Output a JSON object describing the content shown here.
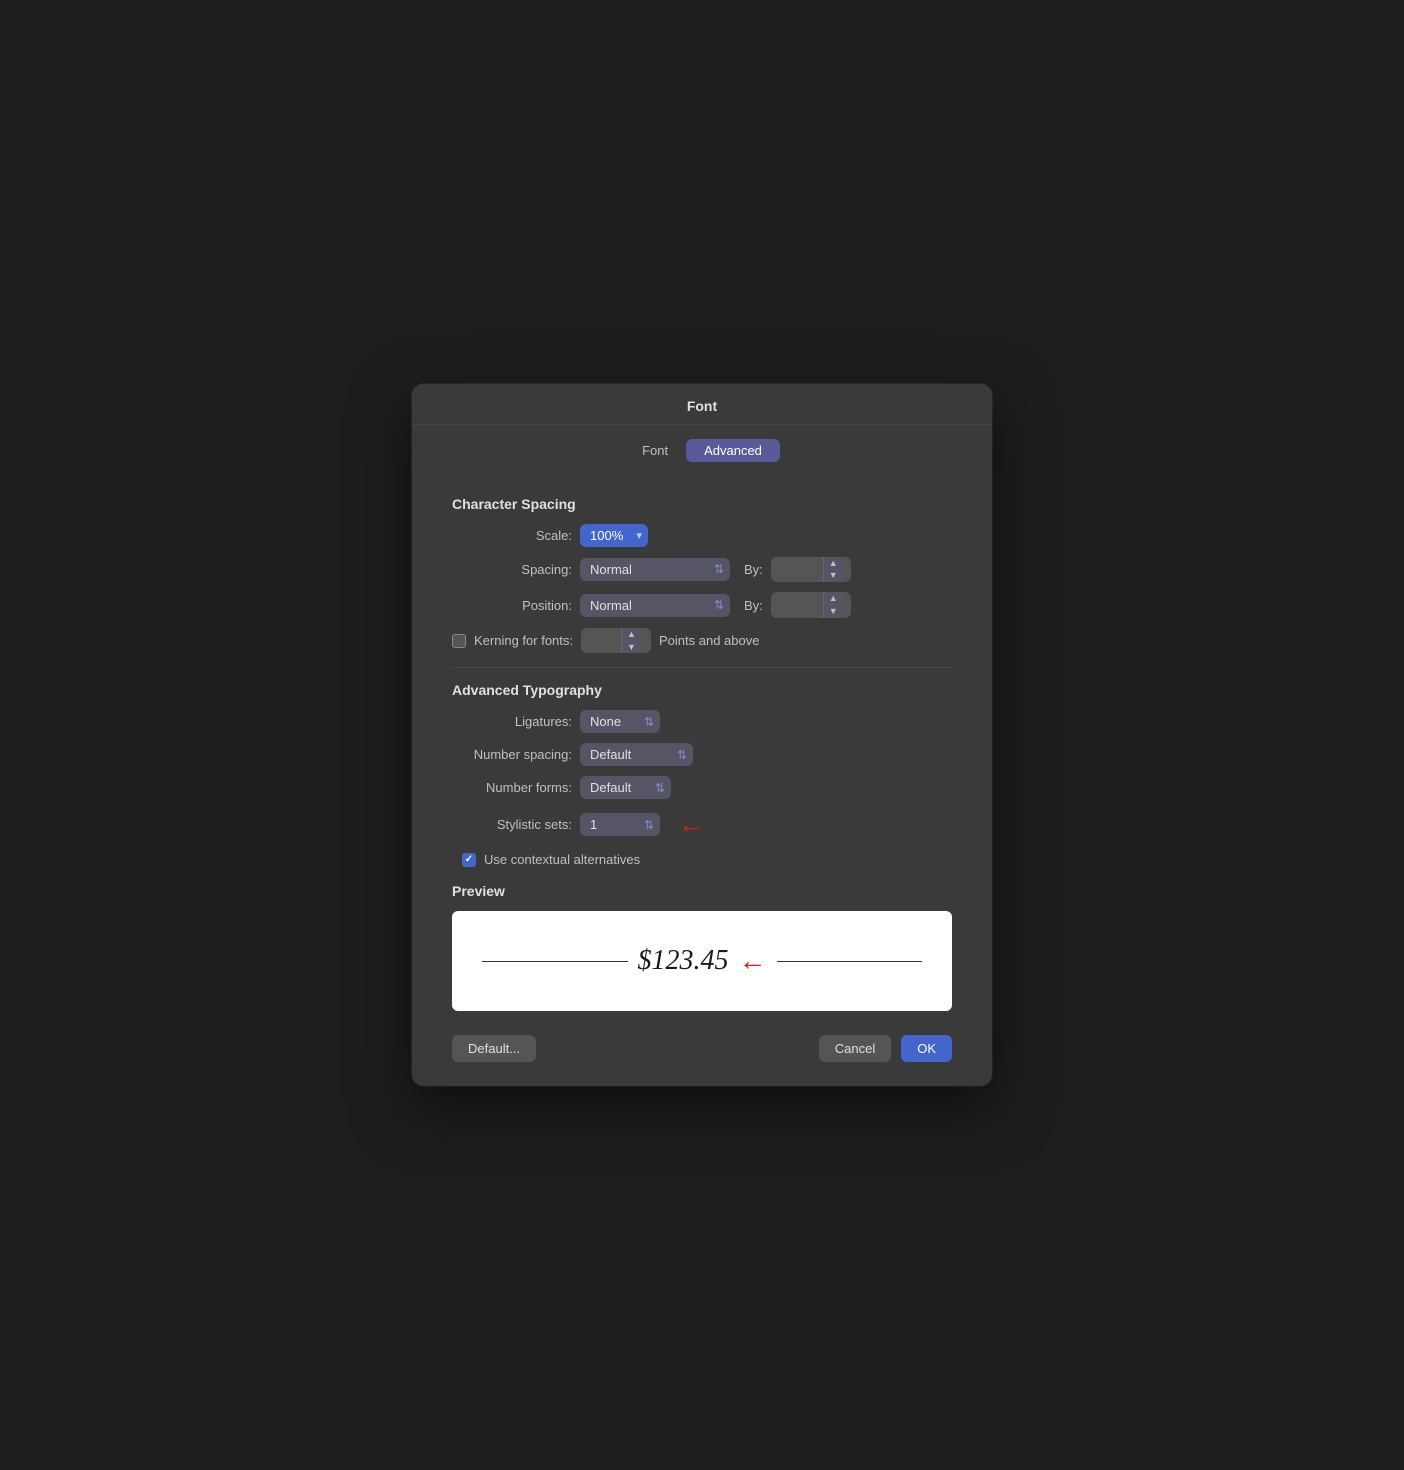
{
  "dialog": {
    "title": "Font",
    "tabs": [
      {
        "label": "Font",
        "active": false
      },
      {
        "label": "Advanced",
        "active": true
      }
    ]
  },
  "character_spacing": {
    "section_title": "Character Spacing",
    "scale_label": "Scale:",
    "scale_value": "100%",
    "spacing_label": "Spacing:",
    "spacing_value": "Normal",
    "spacing_by_label": "By:",
    "position_label": "Position:",
    "position_value": "Normal",
    "position_by_label": "By:",
    "kerning_label": "Kerning for fonts:",
    "kerning_value": "",
    "points_above_label": "Points and above"
  },
  "advanced_typography": {
    "section_title": "Advanced Typography",
    "ligatures_label": "Ligatures:",
    "ligatures_value": "None",
    "number_spacing_label": "Number spacing:",
    "number_spacing_value": "Default",
    "number_forms_label": "Number forms:",
    "number_forms_value": "Default",
    "stylistic_sets_label": "Stylistic sets:",
    "stylistic_sets_value": "1",
    "contextual_label": "Use contextual alternatives",
    "contextual_checked": true
  },
  "preview": {
    "section_title": "Preview",
    "text": "$123.45"
  },
  "footer": {
    "default_label": "Default...",
    "cancel_label": "Cancel",
    "ok_label": "OK"
  }
}
